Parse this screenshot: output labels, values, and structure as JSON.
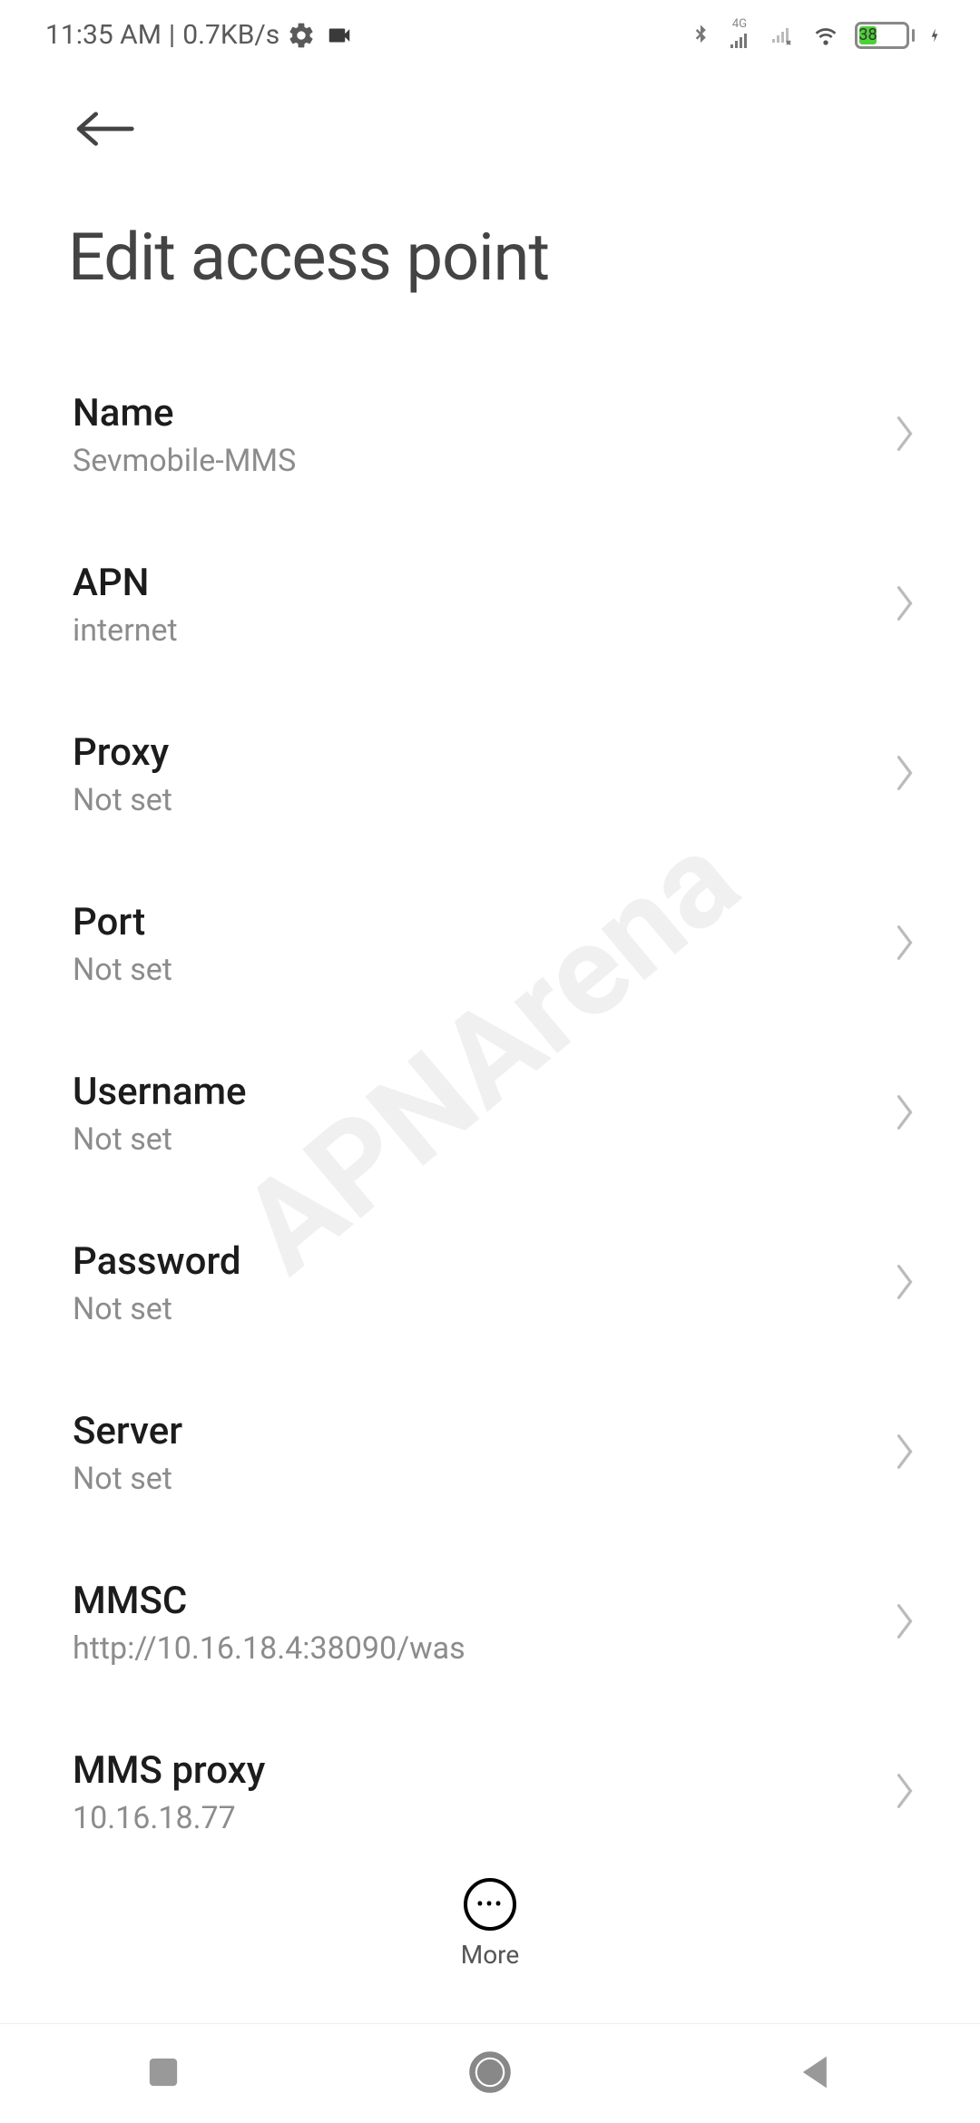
{
  "status": {
    "time": "11:35 AM",
    "rate": "0.7KB/s",
    "data_label_4g": "4G",
    "battery_pct": "38"
  },
  "page_title": "Edit access point",
  "settings": [
    {
      "label": "Name",
      "value": "Sevmobile-MMS"
    },
    {
      "label": "APN",
      "value": "internet"
    },
    {
      "label": "Proxy",
      "value": "Not set"
    },
    {
      "label": "Port",
      "value": "Not set"
    },
    {
      "label": "Username",
      "value": "Not set"
    },
    {
      "label": "Password",
      "value": "Not set"
    },
    {
      "label": "Server",
      "value": "Not set"
    },
    {
      "label": "MMSC",
      "value": "http://10.16.18.4:38090/was"
    },
    {
      "label": "MMS proxy",
      "value": "10.16.18.77"
    }
  ],
  "more_label": "More",
  "watermark": "APNArena"
}
